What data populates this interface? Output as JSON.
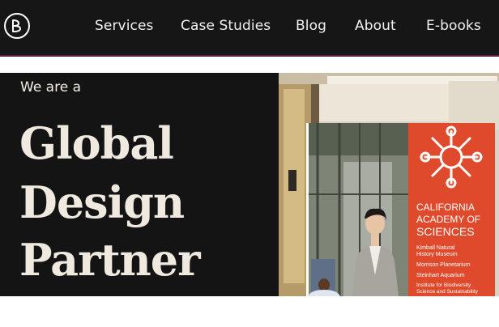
{
  "nav": {
    "logo_icon": "b-monogram-logo-icon",
    "items": [
      {
        "label": "Services"
      },
      {
        "label": "Case Studies"
      },
      {
        "label": "Blog"
      },
      {
        "label": "About"
      },
      {
        "label": "E-books"
      }
    ],
    "colors": {
      "background": "#161617",
      "accent_line": "#5a1b45",
      "text": "#f2f2f2"
    }
  },
  "hero": {
    "eyebrow": "We are a",
    "headline": [
      "Global",
      "Design",
      "Partner"
    ],
    "colors": {
      "background": "#141414",
      "text": "#efe9e0"
    }
  },
  "photo": {
    "sign": {
      "lines": [
        "CALIFORNIA",
        "ACADEMY OF",
        "SCIENCES"
      ],
      "sublines": [
        "Kimball Natural",
        "History Museum",
        "Morrison Planetarium",
        "Steinhart Aquarium",
        "Institute for Biodiversity",
        "Science and Sustainability"
      ],
      "color": "#e04a2c"
    }
  }
}
